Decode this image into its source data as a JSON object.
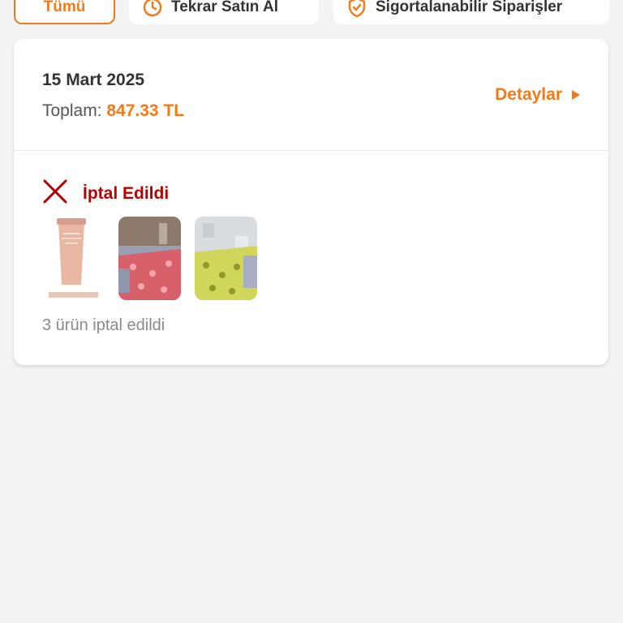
{
  "filters": [
    {
      "label": "Tümü",
      "icon": "",
      "active": true
    },
    {
      "label": "Tekrar Satın Al",
      "icon": "repeat-icon",
      "active": false
    },
    {
      "label": "Sigortalanabilir Siparişler",
      "icon": "shield-icon",
      "active": false
    }
  ],
  "order": {
    "date": "15 Mart 2025",
    "total_label": "Toplam:",
    "total_amount": "847.33 TL",
    "details_label": "Detaylar",
    "status": "İptal Edildi",
    "note": "3 ürün iptal edildi"
  },
  "colors": {
    "accent": "#f27a1a",
    "cancel": "#b30000",
    "background": "#f3f3f3"
  }
}
